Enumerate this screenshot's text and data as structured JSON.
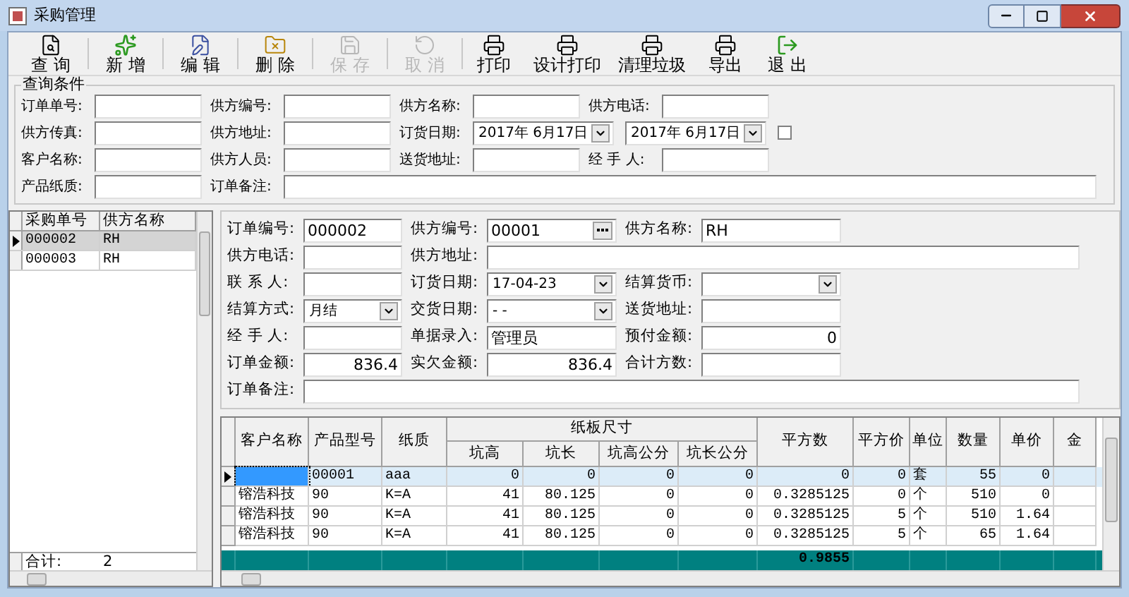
{
  "window": {
    "title": "采购管理"
  },
  "toolbar": [
    {
      "label": "查 询",
      "kind": "search",
      "disabled": false
    },
    {
      "label": "新 增",
      "kind": "new",
      "disabled": false
    },
    {
      "label": "编 辑",
      "kind": "edit",
      "disabled": false
    },
    {
      "label": "删 除",
      "kind": "delete",
      "disabled": false
    },
    {
      "label": "保 存",
      "kind": "save",
      "disabled": true
    },
    {
      "label": "取 消",
      "kind": "undo",
      "disabled": true
    },
    {
      "label": "打印",
      "kind": "print",
      "disabled": false
    },
    {
      "label": "设计打印",
      "kind": "print",
      "disabled": false
    },
    {
      "label": "清理垃圾",
      "kind": "print",
      "disabled": false
    },
    {
      "label": "导出",
      "kind": "print",
      "disabled": false
    },
    {
      "label": "退 出",
      "kind": "exit",
      "disabled": false
    }
  ],
  "query": {
    "title": "查询条件",
    "rows": [
      [
        {
          "kind": "text",
          "label": "订单单号:"
        },
        {
          "kind": "text",
          "label": "供方编号:"
        },
        {
          "kind": "text",
          "label": "供方名称:"
        },
        {
          "kind": "text",
          "label": "供方电话:"
        }
      ],
      [
        {
          "kind": "text",
          "label": "供方传真:"
        },
        {
          "kind": "text",
          "label": "供方地址:"
        },
        {
          "kind": "date",
          "label": "订货日期:",
          "value": "2017年 6月17日"
        },
        {
          "kind": "date",
          "value": "2017年 6月17日"
        },
        {
          "kind": "checkbox",
          "checked": false
        }
      ],
      [
        {
          "kind": "text",
          "label": "客户名称:"
        },
        {
          "kind": "text",
          "label": "供方人员:"
        },
        {
          "kind": "text",
          "label": "送货地址:"
        },
        {
          "kind": "text",
          "label": "经 手 人:"
        }
      ],
      [
        {
          "kind": "text",
          "label": "产品纸质:"
        },
        {
          "kind": "wide",
          "label": "订单备注:"
        }
      ]
    ]
  },
  "order_list": {
    "columns": [
      "采购单号",
      "供方名称"
    ],
    "rows": [
      {
        "cells": [
          "000002",
          "RH"
        ],
        "selected": true
      },
      {
        "cells": [
          "000003",
          "RH"
        ],
        "selected": false
      }
    ],
    "footer": [
      "合计:",
      "2"
    ]
  },
  "form": [
    [
      {
        "kind": "text",
        "label": "订单编号:",
        "value": "000002"
      },
      {
        "kind": "lookup",
        "label": "供方编号:",
        "value": "00001"
      },
      {
        "kind": "text",
        "label": "供方名称:",
        "value": "RH"
      }
    ],
    [
      {
        "kind": "text",
        "label": "供方电话:"
      },
      {
        "kind": "text",
        "label": "供方地址:"
      }
    ],
    [
      {
        "kind": "text",
        "label": "联 系 人:"
      },
      {
        "kind": "dropdown",
        "label": "订货日期:",
        "value": "17-04-23"
      },
      {
        "kind": "dropdown",
        "label": "结算货币:"
      }
    ],
    [
      {
        "kind": "dropdown",
        "label": "结算方式:",
        "value": "月结"
      },
      {
        "kind": "dropdown",
        "label": "交货日期:",
        "value": "-  -"
      },
      {
        "kind": "text",
        "label": "送货地址:"
      }
    ],
    [
      {
        "kind": "text",
        "label": "经 手 人:"
      },
      {
        "kind": "text",
        "label": "单据录入:",
        "value": "管理员"
      },
      {
        "kind": "number",
        "label": "预付金额:",
        "value": "0"
      }
    ],
    [
      {
        "kind": "number",
        "label": "订单金额:",
        "value": "836.4"
      },
      {
        "kind": "number",
        "label": "实欠金额:",
        "value": "836.4"
      },
      {
        "kind": "text",
        "label": "合计方数:"
      }
    ],
    [
      {
        "kind": "text",
        "label": "订单备注:"
      }
    ]
  ],
  "grid": {
    "column_group": "纸板尺寸",
    "columns": [
      {
        "label": "客户名称",
        "kind": "text",
        "grouped": false
      },
      {
        "label": "产品型号",
        "kind": "text",
        "grouped": false
      },
      {
        "label": "纸质",
        "kind": "text",
        "grouped": false
      },
      {
        "label": "坑高",
        "kind": "number",
        "grouped": true
      },
      {
        "label": "坑长",
        "kind": "number",
        "grouped": true
      },
      {
        "label": "坑高公分",
        "kind": "number",
        "grouped": true
      },
      {
        "label": "坑长公分",
        "kind": "number",
        "grouped": true
      },
      {
        "label": "平方数",
        "kind": "number",
        "grouped": false,
        "total": "0.9855"
      },
      {
        "label": "平方价",
        "kind": "number",
        "grouped": false
      },
      {
        "label": "单位",
        "kind": "text",
        "grouped": false
      },
      {
        "label": "数量",
        "kind": "number",
        "grouped": false
      },
      {
        "label": "单价",
        "kind": "number",
        "grouped": false
      },
      {
        "label": "金",
        "kind": "number",
        "grouped": false
      }
    ],
    "rows": [
      {
        "selected": true,
        "cells": [
          "",
          "00001",
          "aaa",
          "0",
          "0",
          "0",
          "0",
          "0",
          "0",
          "套",
          "55",
          "0",
          ""
        ]
      },
      {
        "selected": false,
        "cells": [
          "镕浩科技",
          "90",
          "K=A",
          "41",
          "80.125",
          "0",
          "0",
          "0.3285125",
          "0",
          "个",
          "510",
          "0",
          ""
        ]
      },
      {
        "selected": false,
        "cells": [
          "镕浩科技",
          "90",
          "K=A",
          "41",
          "80.125",
          "0",
          "0",
          "0.3285125",
          "5",
          "个",
          "510",
          "1.64",
          ""
        ]
      },
      {
        "selected": false,
        "cells": [
          "镕浩科技",
          "90",
          "K=A",
          "41",
          "80.125",
          "0",
          "0",
          "0.3285125",
          "5",
          "个",
          "65",
          "1.64",
          ""
        ]
      }
    ]
  }
}
